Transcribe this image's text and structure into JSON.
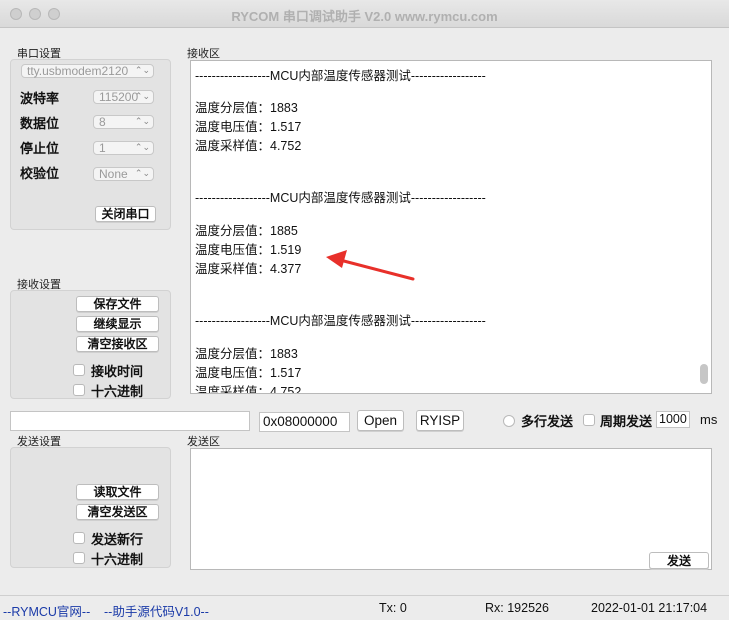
{
  "window": {
    "title": "RYCOM 串口调试助手 V2.0 www.rymcu.com"
  },
  "serial": {
    "group_label": "串口设置",
    "port": "tty.usbmodem2120",
    "baud_label": "波特率",
    "baud": "115200",
    "databits_label": "数据位",
    "databits": "8",
    "stopbits_label": "停止位",
    "stopbits": "1",
    "parity_label": "校验位",
    "parity": "None",
    "close_button": "关闭串口"
  },
  "recv_settings": {
    "group_label": "接收设置",
    "save_file": "保存文件",
    "continue_display": "继续显示",
    "clear_recv": "清空接收区",
    "recv_time": "接收时间",
    "hex": "十六进制"
  },
  "recv_area": {
    "label": "接收区",
    "lines": [
      "------------------MCU内部温度传感器测试------------------",
      "",
      "温度分层值：1883",
      "温度电压值：1.517",
      "温度采样值：4.752",
      "",
      "",
      "------------------MCU内部温度传感器测试------------------",
      "",
      "温度分层值：1885",
      "温度电压值：1.519",
      "温度采样值：4.377",
      "",
      "",
      "------------------MCU内部温度传感器测试------------------",
      "",
      "温度分层值：1883",
      "温度电压值：1.517",
      "温度采样值：4.752"
    ]
  },
  "toolbar": {
    "address": "0x08000000",
    "open_button": "Open",
    "ryisp_button": "RYISP",
    "multi_send": "多行发送",
    "periodic_send": "周期发送",
    "period_value": "1000",
    "period_unit": "ms"
  },
  "send_settings": {
    "group_label": "发送设置",
    "read_file": "读取文件",
    "clear_send": "清空发送区",
    "send_newline": "发送新行",
    "hex": "十六进制"
  },
  "send_area": {
    "label": "发送区",
    "send_button": "发送"
  },
  "status": {
    "website": "--RYMCU官网--",
    "source": "--助手源代码V1.0--",
    "tx": "Tx: 0",
    "rx": "Rx: 192526",
    "datetime": "2022-01-01 21:17:04"
  },
  "colors": {
    "annotation_arrow": "#e8302a",
    "link": "#1a3aa8"
  }
}
